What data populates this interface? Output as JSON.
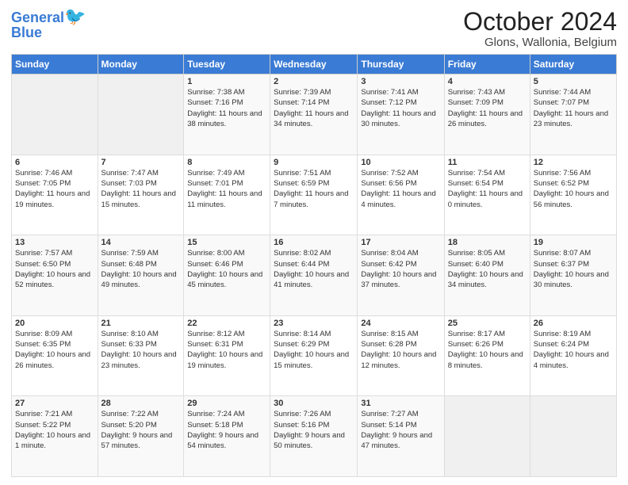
{
  "header": {
    "logo_line1": "General",
    "logo_line2": "Blue",
    "title": "October 2024",
    "subtitle": "Glons, Wallonia, Belgium"
  },
  "weekdays": [
    "Sunday",
    "Monday",
    "Tuesday",
    "Wednesday",
    "Thursday",
    "Friday",
    "Saturday"
  ],
  "weeks": [
    [
      {
        "day": "",
        "sunrise": "",
        "sunset": "",
        "daylight": ""
      },
      {
        "day": "",
        "sunrise": "",
        "sunset": "",
        "daylight": ""
      },
      {
        "day": "1",
        "sunrise": "Sunrise: 7:38 AM",
        "sunset": "Sunset: 7:16 PM",
        "daylight": "Daylight: 11 hours and 38 minutes."
      },
      {
        "day": "2",
        "sunrise": "Sunrise: 7:39 AM",
        "sunset": "Sunset: 7:14 PM",
        "daylight": "Daylight: 11 hours and 34 minutes."
      },
      {
        "day": "3",
        "sunrise": "Sunrise: 7:41 AM",
        "sunset": "Sunset: 7:12 PM",
        "daylight": "Daylight: 11 hours and 30 minutes."
      },
      {
        "day": "4",
        "sunrise": "Sunrise: 7:43 AM",
        "sunset": "Sunset: 7:09 PM",
        "daylight": "Daylight: 11 hours and 26 minutes."
      },
      {
        "day": "5",
        "sunrise": "Sunrise: 7:44 AM",
        "sunset": "Sunset: 7:07 PM",
        "daylight": "Daylight: 11 hours and 23 minutes."
      }
    ],
    [
      {
        "day": "6",
        "sunrise": "Sunrise: 7:46 AM",
        "sunset": "Sunset: 7:05 PM",
        "daylight": "Daylight: 11 hours and 19 minutes."
      },
      {
        "day": "7",
        "sunrise": "Sunrise: 7:47 AM",
        "sunset": "Sunset: 7:03 PM",
        "daylight": "Daylight: 11 hours and 15 minutes."
      },
      {
        "day": "8",
        "sunrise": "Sunrise: 7:49 AM",
        "sunset": "Sunset: 7:01 PM",
        "daylight": "Daylight: 11 hours and 11 minutes."
      },
      {
        "day": "9",
        "sunrise": "Sunrise: 7:51 AM",
        "sunset": "Sunset: 6:59 PM",
        "daylight": "Daylight: 11 hours and 7 minutes."
      },
      {
        "day": "10",
        "sunrise": "Sunrise: 7:52 AM",
        "sunset": "Sunset: 6:56 PM",
        "daylight": "Daylight: 11 hours and 4 minutes."
      },
      {
        "day": "11",
        "sunrise": "Sunrise: 7:54 AM",
        "sunset": "Sunset: 6:54 PM",
        "daylight": "Daylight: 11 hours and 0 minutes."
      },
      {
        "day": "12",
        "sunrise": "Sunrise: 7:56 AM",
        "sunset": "Sunset: 6:52 PM",
        "daylight": "Daylight: 10 hours and 56 minutes."
      }
    ],
    [
      {
        "day": "13",
        "sunrise": "Sunrise: 7:57 AM",
        "sunset": "Sunset: 6:50 PM",
        "daylight": "Daylight: 10 hours and 52 minutes."
      },
      {
        "day": "14",
        "sunrise": "Sunrise: 7:59 AM",
        "sunset": "Sunset: 6:48 PM",
        "daylight": "Daylight: 10 hours and 49 minutes."
      },
      {
        "day": "15",
        "sunrise": "Sunrise: 8:00 AM",
        "sunset": "Sunset: 6:46 PM",
        "daylight": "Daylight: 10 hours and 45 minutes."
      },
      {
        "day": "16",
        "sunrise": "Sunrise: 8:02 AM",
        "sunset": "Sunset: 6:44 PM",
        "daylight": "Daylight: 10 hours and 41 minutes."
      },
      {
        "day": "17",
        "sunrise": "Sunrise: 8:04 AM",
        "sunset": "Sunset: 6:42 PM",
        "daylight": "Daylight: 10 hours and 37 minutes."
      },
      {
        "day": "18",
        "sunrise": "Sunrise: 8:05 AM",
        "sunset": "Sunset: 6:40 PM",
        "daylight": "Daylight: 10 hours and 34 minutes."
      },
      {
        "day": "19",
        "sunrise": "Sunrise: 8:07 AM",
        "sunset": "Sunset: 6:37 PM",
        "daylight": "Daylight: 10 hours and 30 minutes."
      }
    ],
    [
      {
        "day": "20",
        "sunrise": "Sunrise: 8:09 AM",
        "sunset": "Sunset: 6:35 PM",
        "daylight": "Daylight: 10 hours and 26 minutes."
      },
      {
        "day": "21",
        "sunrise": "Sunrise: 8:10 AM",
        "sunset": "Sunset: 6:33 PM",
        "daylight": "Daylight: 10 hours and 23 minutes."
      },
      {
        "day": "22",
        "sunrise": "Sunrise: 8:12 AM",
        "sunset": "Sunset: 6:31 PM",
        "daylight": "Daylight: 10 hours and 19 minutes."
      },
      {
        "day": "23",
        "sunrise": "Sunrise: 8:14 AM",
        "sunset": "Sunset: 6:29 PM",
        "daylight": "Daylight: 10 hours and 15 minutes."
      },
      {
        "day": "24",
        "sunrise": "Sunrise: 8:15 AM",
        "sunset": "Sunset: 6:28 PM",
        "daylight": "Daylight: 10 hours and 12 minutes."
      },
      {
        "day": "25",
        "sunrise": "Sunrise: 8:17 AM",
        "sunset": "Sunset: 6:26 PM",
        "daylight": "Daylight: 10 hours and 8 minutes."
      },
      {
        "day": "26",
        "sunrise": "Sunrise: 8:19 AM",
        "sunset": "Sunset: 6:24 PM",
        "daylight": "Daylight: 10 hours and 4 minutes."
      }
    ],
    [
      {
        "day": "27",
        "sunrise": "Sunrise: 7:21 AM",
        "sunset": "Sunset: 5:22 PM",
        "daylight": "Daylight: 10 hours and 1 minute."
      },
      {
        "day": "28",
        "sunrise": "Sunrise: 7:22 AM",
        "sunset": "Sunset: 5:20 PM",
        "daylight": "Daylight: 9 hours and 57 minutes."
      },
      {
        "day": "29",
        "sunrise": "Sunrise: 7:24 AM",
        "sunset": "Sunset: 5:18 PM",
        "daylight": "Daylight: 9 hours and 54 minutes."
      },
      {
        "day": "30",
        "sunrise": "Sunrise: 7:26 AM",
        "sunset": "Sunset: 5:16 PM",
        "daylight": "Daylight: 9 hours and 50 minutes."
      },
      {
        "day": "31",
        "sunrise": "Sunrise: 7:27 AM",
        "sunset": "Sunset: 5:14 PM",
        "daylight": "Daylight: 9 hours and 47 minutes."
      },
      {
        "day": "",
        "sunrise": "",
        "sunset": "",
        "daylight": ""
      },
      {
        "day": "",
        "sunrise": "",
        "sunset": "",
        "daylight": ""
      }
    ]
  ]
}
